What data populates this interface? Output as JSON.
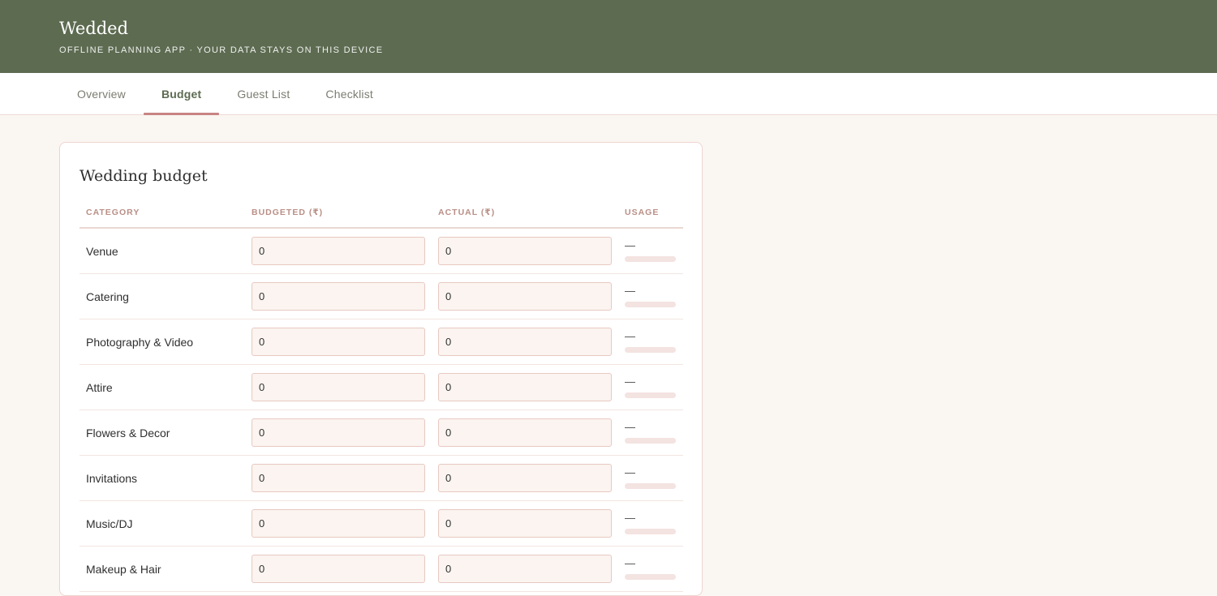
{
  "header": {
    "title": "Wedded",
    "subtitle": "OFFLINE PLANNING APP · YOUR DATA STAYS ON THIS DEVICE"
  },
  "tabs": [
    {
      "label": "Overview",
      "active": false
    },
    {
      "label": "Budget",
      "active": true
    },
    {
      "label": "Guest List",
      "active": false
    },
    {
      "label": "Checklist",
      "active": false
    }
  ],
  "budget": {
    "title": "Wedding budget",
    "columns": {
      "category": "CATEGORY",
      "budgeted": "BUDGETED (₹)",
      "actual": "ACTUAL (₹)",
      "usage": "USAGE"
    },
    "rows": [
      {
        "category": "Venue",
        "budgeted": "0",
        "actual": "0",
        "usage": "—",
        "usage_fraction": 0
      },
      {
        "category": "Catering",
        "budgeted": "0",
        "actual": "0",
        "usage": "—",
        "usage_fraction": 0
      },
      {
        "category": "Photography & Video",
        "budgeted": "0",
        "actual": "0",
        "usage": "—",
        "usage_fraction": 0
      },
      {
        "category": "Attire",
        "budgeted": "0",
        "actual": "0",
        "usage": "—",
        "usage_fraction": 0
      },
      {
        "category": "Flowers & Decor",
        "budgeted": "0",
        "actual": "0",
        "usage": "—",
        "usage_fraction": 0
      },
      {
        "category": "Invitations",
        "budgeted": "0",
        "actual": "0",
        "usage": "—",
        "usage_fraction": 0
      },
      {
        "category": "Music/DJ",
        "budgeted": "0",
        "actual": "0",
        "usage": "—",
        "usage_fraction": 0
      },
      {
        "category": "Makeup & Hair",
        "budgeted": "0",
        "actual": "0",
        "usage": "—",
        "usage_fraction": 0
      }
    ]
  },
  "colors": {
    "header_bg": "#5d6b51",
    "accent": "#c78483",
    "page_bg": "#faf6f2"
  }
}
